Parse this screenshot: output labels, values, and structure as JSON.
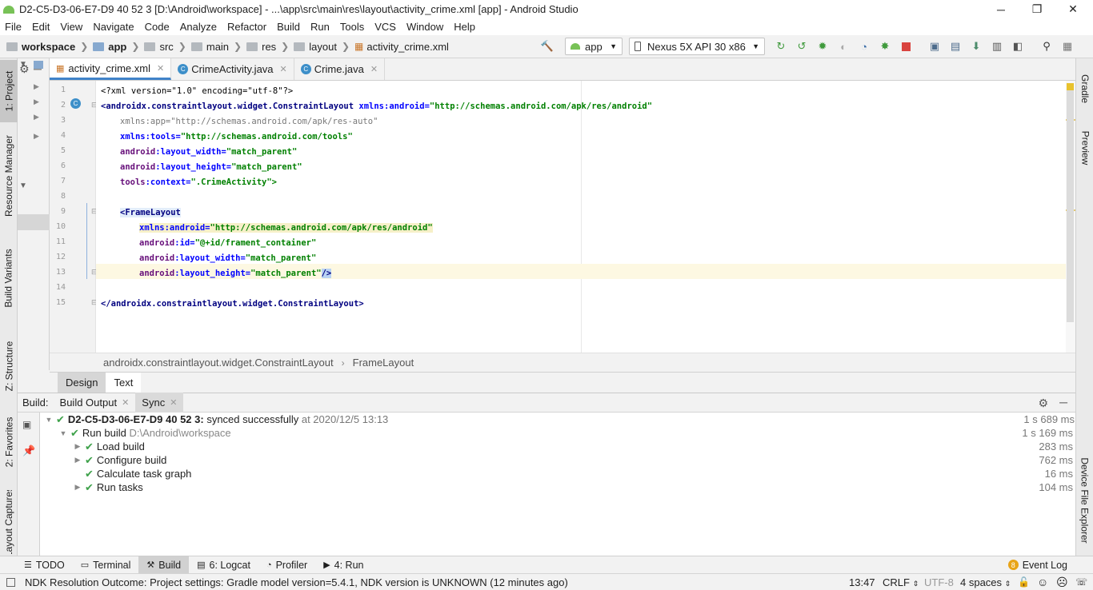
{
  "window": {
    "title": "D2-C5-D3-06-E7-D9 40 52 3 [D:\\Android\\workspace] - ...\\app\\src\\main\\res\\layout\\activity_crime.xml [app] - Android Studio",
    "minimize": "─",
    "restore": "❐",
    "close": "✕"
  },
  "menu": [
    "File",
    "Edit",
    "View",
    "Navigate",
    "Code",
    "Analyze",
    "Refactor",
    "Build",
    "Run",
    "Tools",
    "VCS",
    "Window",
    "Help"
  ],
  "nav": {
    "crumbs": [
      "workspace",
      "app",
      "src",
      "main",
      "res",
      "layout",
      "activity_crime.xml"
    ],
    "config": "app",
    "device": "Nexus 5X API 30 x86"
  },
  "left_tabs": [
    "1: Project",
    "Resource Manager",
    "Build Variants",
    "Z: Structure",
    "2: Favorites",
    "Layout Captures"
  ],
  "right_tabs": [
    "Gradle",
    "Preview",
    "Device File Explorer"
  ],
  "editor_tabs": [
    {
      "label": "activity_crime.xml",
      "active": true
    },
    {
      "label": "CrimeActivity.java",
      "active": false
    },
    {
      "label": "Crime.java",
      "active": false
    }
  ],
  "code_lines": [
    {
      "n": "1"
    },
    {
      "n": "2"
    },
    {
      "n": "3"
    },
    {
      "n": "4"
    },
    {
      "n": "5"
    },
    {
      "n": "6"
    },
    {
      "n": "7"
    },
    {
      "n": "8"
    },
    {
      "n": "9"
    },
    {
      "n": "10"
    },
    {
      "n": "11"
    },
    {
      "n": "12"
    },
    {
      "n": "13"
    },
    {
      "n": "14"
    },
    {
      "n": "15"
    }
  ],
  "code": {
    "l1": "<?xml version=\"1.0\" encoding=\"utf-8\"?>",
    "l2_tag": "<androidx.constraintlayout.widget.ConstraintLayout",
    "l2_attr": " xmlns:android=",
    "l2_val": "\"http://schemas.android.com/apk/res/android\"",
    "l3": "xmlns:app=\"http://schemas.android.com/apk/res-auto\"",
    "l4_attr": "xmlns:tools=",
    "l4_val": "\"http://schemas.android.com/tools\"",
    "l5_ns": "android",
    "l5_attr": ":layout_width=",
    "l5_val": "\"match_parent\"",
    "l6_ns": "android",
    "l6_attr": ":layout_height=",
    "l6_val": "\"match_parent\"",
    "l7_ns": "tools",
    "l7_attr": ":context=",
    "l7_val": "\".CrimeActivity\">",
    "l9": "<FrameLayout",
    "l10_attr": "xmlns:android=",
    "l10_val": "\"http://schemas.android.com/apk/res/android\"",
    "l11_ns": "android",
    "l11_attr": ":id=",
    "l11_val": "\"@+id/frament_container\"",
    "l12_ns": "android",
    "l12_attr": ":layout_width=",
    "l12_val": "\"match_parent\"",
    "l13_ns": "android",
    "l13_attr": ":layout_height=",
    "l13_val": "\"match_parent\"",
    "l13_end": "/>",
    "l15": "</androidx.constraintlayout.widget.ConstraintLayout>"
  },
  "breadcrumb": [
    "androidx.constraintlayout.widget.ConstraintLayout",
    "FrameLayout"
  ],
  "design_tabs": [
    "Design",
    "Text"
  ],
  "build": {
    "label": "Build:",
    "tabs": [
      "Build Output",
      "Sync"
    ],
    "rows": [
      {
        "text": "D2-C5-D3-06-E7-D9 40 52 3:",
        "suffix": "synced successfully",
        "extra": "at 2020/12/5 13:13",
        "time": "1 s 689 ms"
      },
      {
        "text": "Run build",
        "extra": "D:\\Android\\workspace",
        "time": "1 s 169 ms"
      },
      {
        "text": "Load build",
        "time": "283 ms"
      },
      {
        "text": "Configure build",
        "time": "762 ms"
      },
      {
        "text": "Calculate task graph",
        "time": "16 ms"
      },
      {
        "text": "Run tasks",
        "time": "104 ms"
      }
    ]
  },
  "bottom_tabs": [
    "TODO",
    "Terminal",
    "Build",
    "6: Logcat",
    "Profiler",
    "4: Run"
  ],
  "event_log": {
    "count": "8",
    "label": "Event Log"
  },
  "status": {
    "message": "NDK Resolution Outcome: Project settings: Gradle model version=5.4.1, NDK version is UNKNOWN (12 minutes ago)",
    "position": "13:47",
    "line_sep": "CRLF",
    "encoding": "UTF-8",
    "indent": "4 spaces"
  }
}
